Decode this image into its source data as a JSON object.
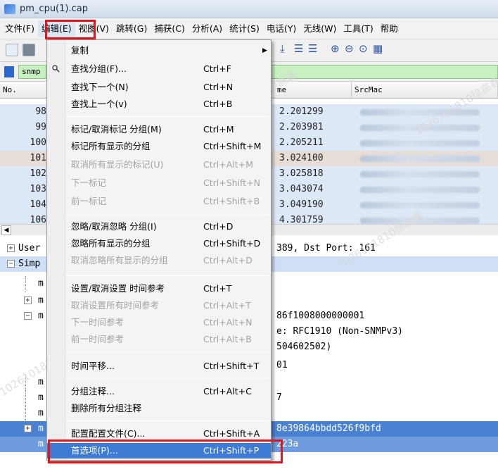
{
  "window": {
    "title": "pm_cpu(1).cap"
  },
  "menubar": {
    "items": [
      {
        "label": "文件(F)",
        "name": "menu-file"
      },
      {
        "label": "编辑(E)",
        "name": "menu-edit"
      },
      {
        "label": "视图(V)",
        "name": "menu-view"
      },
      {
        "label": "跳转(G)",
        "name": "menu-go"
      },
      {
        "label": "捕获(C)",
        "name": "menu-capture"
      },
      {
        "label": "分析(A)",
        "name": "menu-analyze"
      },
      {
        "label": "统计(S)",
        "name": "menu-statistics"
      },
      {
        "label": "电话(Y)",
        "name": "menu-telephony"
      },
      {
        "label": "无线(W)",
        "name": "menu-wireless"
      },
      {
        "label": "工具(T)",
        "name": "menu-tools"
      },
      {
        "label": "帮助",
        "name": "menu-help"
      }
    ]
  },
  "filter": {
    "value": "snmp"
  },
  "packet_list": {
    "headers": {
      "no": "No.",
      "time": "me",
      "src_mac": "SrcMac"
    },
    "rows": [
      {
        "no": "98",
        "time": "2.201299"
      },
      {
        "no": "99",
        "time": "2.203981"
      },
      {
        "no": "100",
        "time": "2.205211"
      },
      {
        "no": "101",
        "time": "3.024100"
      },
      {
        "no": "102",
        "time": "3.025818"
      },
      {
        "no": "103",
        "time": "3.043074"
      },
      {
        "no": "104",
        "time": "3.049190"
      },
      {
        "no": "106",
        "time": "4.301759"
      }
    ]
  },
  "details": {
    "rows": [
      {
        "prefix": "User",
        "tail": "389, Dst Port: 161"
      },
      {
        "prefix": "Simp",
        "tail": ""
      },
      {
        "prefix": "m",
        "tail": ""
      },
      {
        "prefix": "m",
        "tail": ""
      },
      {
        "prefix": "m",
        "tail": "86f1008000000001"
      },
      {
        "prefix": "",
        "tail": "e: RFC1910 (Non-SNMPv3)"
      },
      {
        "prefix": "",
        "tail": "504602502)"
      },
      {
        "prefix": "",
        "tail": "01"
      },
      {
        "prefix": "m",
        "tail": ""
      },
      {
        "prefix": "m",
        "tail": "7"
      },
      {
        "prefix": "m",
        "tail": ""
      },
      {
        "prefix": "m",
        "tail": "8e39864bbdd526f9bfd"
      },
      {
        "prefix": "m",
        "tail": "223a"
      },
      {
        "prefix": "m",
        "tail": ""
      }
    ]
  },
  "edit_menu": {
    "items": [
      {
        "label": "复制",
        "shortcut": "",
        "disabled": false,
        "submenu": true
      },
      {
        "label": "查找分组(F)...",
        "shortcut": "Ctrl+F",
        "disabled": false,
        "icon": "search-icon"
      },
      {
        "label": "查找下一个(N)",
        "shortcut": "Ctrl+N",
        "disabled": false
      },
      {
        "label": "查找上一个(v)",
        "shortcut": "Ctrl+B",
        "disabled": false
      },
      {
        "label": "标记/取消标记 分组(M)",
        "shortcut": "Ctrl+M",
        "disabled": false
      },
      {
        "label": "标记所有显示的分组",
        "shortcut": "Ctrl+Shift+M",
        "disabled": false
      },
      {
        "label": "取消所有显示的标记(U)",
        "shortcut": "Ctrl+Alt+M",
        "disabled": true
      },
      {
        "label": "下一标记",
        "shortcut": "Ctrl+Shift+N",
        "disabled": true
      },
      {
        "label": "前一标记",
        "shortcut": "Ctrl+Shift+B",
        "disabled": true
      },
      {
        "label": "忽略/取消忽略 分组(I)",
        "shortcut": "Ctrl+D",
        "disabled": false
      },
      {
        "label": "忽略所有显示的分组",
        "shortcut": "Ctrl+Shift+D",
        "disabled": false
      },
      {
        "label": "取消忽略所有显示的分组",
        "shortcut": "Ctrl+Alt+D",
        "disabled": true
      },
      {
        "label": "设置/取消设置 时间参考",
        "shortcut": "Ctrl+T",
        "disabled": false
      },
      {
        "label": "取消设置所有时间参考",
        "shortcut": "Ctrl+Alt+T",
        "disabled": true
      },
      {
        "label": "下一时间参考",
        "shortcut": "Ctrl+Alt+N",
        "disabled": true
      },
      {
        "label": "前一时间参考",
        "shortcut": "Ctrl+Alt+B",
        "disabled": true
      },
      {
        "label": "时间平移...",
        "shortcut": "Ctrl+Shift+T",
        "disabled": false
      },
      {
        "label": "分组注释...",
        "shortcut": "Ctrl+Alt+C",
        "disabled": false
      },
      {
        "label": "删除所有分组注释",
        "shortcut": "",
        "disabled": false
      },
      {
        "label": "配置配置文件(C)...",
        "shortcut": "Ctrl+Shift+A",
        "disabled": false
      },
      {
        "label": "首选项(P)...",
        "shortcut": "Ctrl+Shift+P",
        "disabled": false,
        "selected": true
      }
    ]
  },
  "watermark": {
    "text": "1026101810徐高鑫"
  },
  "colors": {
    "highlight_red": "#e0161c",
    "selection_blue": "#3e7bd4"
  }
}
